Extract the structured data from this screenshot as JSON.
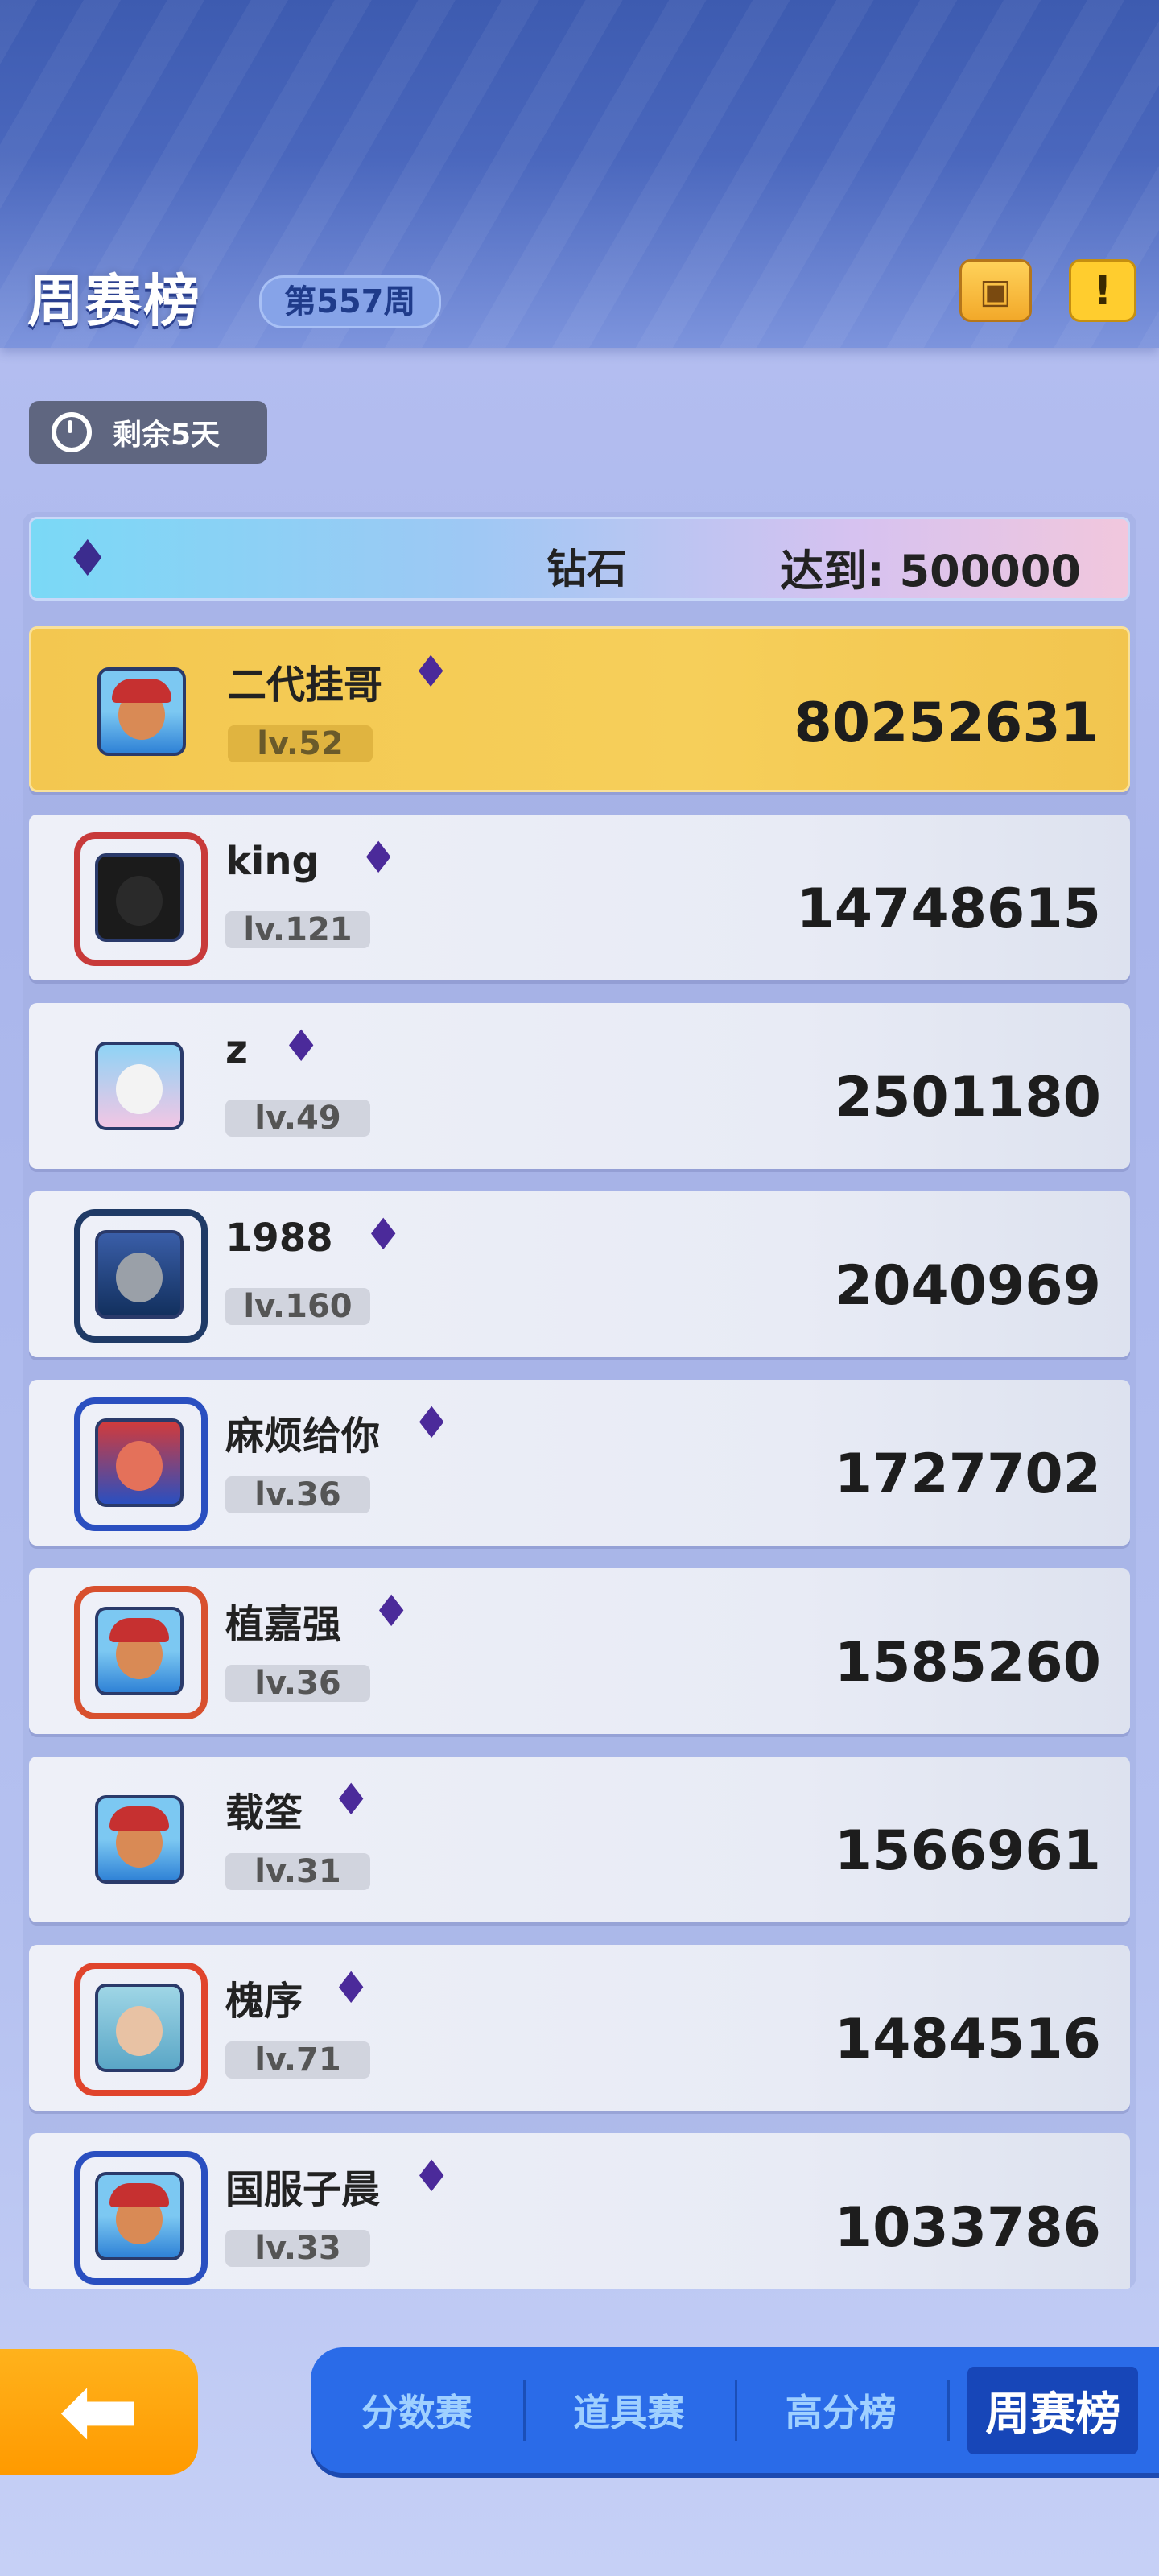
{
  "header": {
    "title": "周赛榜",
    "week_badge": "第557周",
    "chest_icon": "treasure-chest-icon",
    "info_icon": "exclamation-icon",
    "info_label": "!"
  },
  "timer": {
    "icon": "stopwatch-icon",
    "text": "剩余5天"
  },
  "tier": {
    "icon": "diamond-medal-icon",
    "name": "钻石",
    "target": "达到: 500000"
  },
  "leaderboard": [
    {
      "name": "二代挂哥",
      "level": "lv.52",
      "score": "80252631",
      "highlight": true
    },
    {
      "name": "king",
      "level": "lv.121",
      "score": "14748615"
    },
    {
      "name": "z",
      "level": "lv.49",
      "score": "2501180"
    },
    {
      "name": "1988",
      "level": "lv.160",
      "score": "2040969"
    },
    {
      "name": "麻烦给你",
      "level": "lv.36",
      "score": "1727702"
    },
    {
      "name": "植嘉强",
      "level": "lv.36",
      "score": "1585260"
    },
    {
      "name": "载筌",
      "level": "lv.31",
      "score": "1566961"
    },
    {
      "name": "槐序",
      "level": "lv.71",
      "score": "1484516"
    },
    {
      "name": "国服子晨",
      "level": "lv.33",
      "score": "1033786"
    }
  ],
  "back_button": {
    "icon": "back-arrow-icon",
    "glyph": "⬅"
  },
  "tabs": [
    "分数赛",
    "道具赛",
    "高分榜",
    "周赛榜"
  ],
  "active_tab": "周赛榜",
  "colors": {
    "accent_blue": "#2a6be8",
    "gold_row": "#f3c750",
    "back_orange": "#ff9a00"
  }
}
